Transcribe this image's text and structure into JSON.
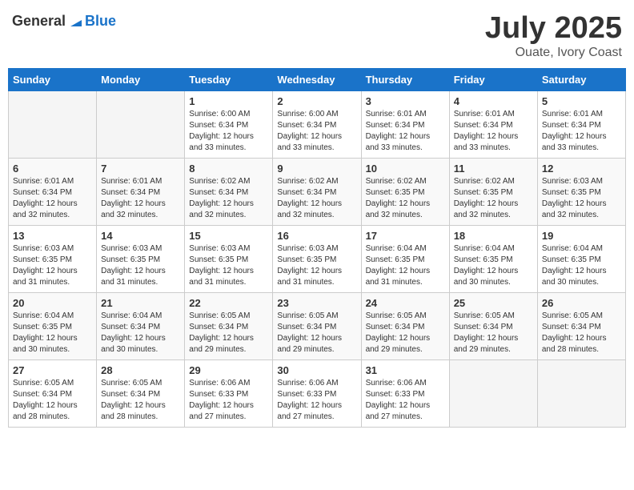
{
  "logo": {
    "general": "General",
    "blue": "Blue"
  },
  "title": "July 2025",
  "subtitle": "Ouate, Ivory Coast",
  "days_of_week": [
    "Sunday",
    "Monday",
    "Tuesday",
    "Wednesday",
    "Thursday",
    "Friday",
    "Saturday"
  ],
  "weeks": [
    [
      {
        "day": "",
        "sunrise": "",
        "sunset": "",
        "daylight": ""
      },
      {
        "day": "",
        "sunrise": "",
        "sunset": "",
        "daylight": ""
      },
      {
        "day": "1",
        "sunrise": "Sunrise: 6:00 AM",
        "sunset": "Sunset: 6:34 PM",
        "daylight": "Daylight: 12 hours and 33 minutes."
      },
      {
        "day": "2",
        "sunrise": "Sunrise: 6:00 AM",
        "sunset": "Sunset: 6:34 PM",
        "daylight": "Daylight: 12 hours and 33 minutes."
      },
      {
        "day": "3",
        "sunrise": "Sunrise: 6:01 AM",
        "sunset": "Sunset: 6:34 PM",
        "daylight": "Daylight: 12 hours and 33 minutes."
      },
      {
        "day": "4",
        "sunrise": "Sunrise: 6:01 AM",
        "sunset": "Sunset: 6:34 PM",
        "daylight": "Daylight: 12 hours and 33 minutes."
      },
      {
        "day": "5",
        "sunrise": "Sunrise: 6:01 AM",
        "sunset": "Sunset: 6:34 PM",
        "daylight": "Daylight: 12 hours and 33 minutes."
      }
    ],
    [
      {
        "day": "6",
        "sunrise": "Sunrise: 6:01 AM",
        "sunset": "Sunset: 6:34 PM",
        "daylight": "Daylight: 12 hours and 32 minutes."
      },
      {
        "day": "7",
        "sunrise": "Sunrise: 6:01 AM",
        "sunset": "Sunset: 6:34 PM",
        "daylight": "Daylight: 12 hours and 32 minutes."
      },
      {
        "day": "8",
        "sunrise": "Sunrise: 6:02 AM",
        "sunset": "Sunset: 6:34 PM",
        "daylight": "Daylight: 12 hours and 32 minutes."
      },
      {
        "day": "9",
        "sunrise": "Sunrise: 6:02 AM",
        "sunset": "Sunset: 6:34 PM",
        "daylight": "Daylight: 12 hours and 32 minutes."
      },
      {
        "day": "10",
        "sunrise": "Sunrise: 6:02 AM",
        "sunset": "Sunset: 6:35 PM",
        "daylight": "Daylight: 12 hours and 32 minutes."
      },
      {
        "day": "11",
        "sunrise": "Sunrise: 6:02 AM",
        "sunset": "Sunset: 6:35 PM",
        "daylight": "Daylight: 12 hours and 32 minutes."
      },
      {
        "day": "12",
        "sunrise": "Sunrise: 6:03 AM",
        "sunset": "Sunset: 6:35 PM",
        "daylight": "Daylight: 12 hours and 32 minutes."
      }
    ],
    [
      {
        "day": "13",
        "sunrise": "Sunrise: 6:03 AM",
        "sunset": "Sunset: 6:35 PM",
        "daylight": "Daylight: 12 hours and 31 minutes."
      },
      {
        "day": "14",
        "sunrise": "Sunrise: 6:03 AM",
        "sunset": "Sunset: 6:35 PM",
        "daylight": "Daylight: 12 hours and 31 minutes."
      },
      {
        "day": "15",
        "sunrise": "Sunrise: 6:03 AM",
        "sunset": "Sunset: 6:35 PM",
        "daylight": "Daylight: 12 hours and 31 minutes."
      },
      {
        "day": "16",
        "sunrise": "Sunrise: 6:03 AM",
        "sunset": "Sunset: 6:35 PM",
        "daylight": "Daylight: 12 hours and 31 minutes."
      },
      {
        "day": "17",
        "sunrise": "Sunrise: 6:04 AM",
        "sunset": "Sunset: 6:35 PM",
        "daylight": "Daylight: 12 hours and 31 minutes."
      },
      {
        "day": "18",
        "sunrise": "Sunrise: 6:04 AM",
        "sunset": "Sunset: 6:35 PM",
        "daylight": "Daylight: 12 hours and 30 minutes."
      },
      {
        "day": "19",
        "sunrise": "Sunrise: 6:04 AM",
        "sunset": "Sunset: 6:35 PM",
        "daylight": "Daylight: 12 hours and 30 minutes."
      }
    ],
    [
      {
        "day": "20",
        "sunrise": "Sunrise: 6:04 AM",
        "sunset": "Sunset: 6:35 PM",
        "daylight": "Daylight: 12 hours and 30 minutes."
      },
      {
        "day": "21",
        "sunrise": "Sunrise: 6:04 AM",
        "sunset": "Sunset: 6:34 PM",
        "daylight": "Daylight: 12 hours and 30 minutes."
      },
      {
        "day": "22",
        "sunrise": "Sunrise: 6:05 AM",
        "sunset": "Sunset: 6:34 PM",
        "daylight": "Daylight: 12 hours and 29 minutes."
      },
      {
        "day": "23",
        "sunrise": "Sunrise: 6:05 AM",
        "sunset": "Sunset: 6:34 PM",
        "daylight": "Daylight: 12 hours and 29 minutes."
      },
      {
        "day": "24",
        "sunrise": "Sunrise: 6:05 AM",
        "sunset": "Sunset: 6:34 PM",
        "daylight": "Daylight: 12 hours and 29 minutes."
      },
      {
        "day": "25",
        "sunrise": "Sunrise: 6:05 AM",
        "sunset": "Sunset: 6:34 PM",
        "daylight": "Daylight: 12 hours and 29 minutes."
      },
      {
        "day": "26",
        "sunrise": "Sunrise: 6:05 AM",
        "sunset": "Sunset: 6:34 PM",
        "daylight": "Daylight: 12 hours and 28 minutes."
      }
    ],
    [
      {
        "day": "27",
        "sunrise": "Sunrise: 6:05 AM",
        "sunset": "Sunset: 6:34 PM",
        "daylight": "Daylight: 12 hours and 28 minutes."
      },
      {
        "day": "28",
        "sunrise": "Sunrise: 6:05 AM",
        "sunset": "Sunset: 6:34 PM",
        "daylight": "Daylight: 12 hours and 28 minutes."
      },
      {
        "day": "29",
        "sunrise": "Sunrise: 6:06 AM",
        "sunset": "Sunset: 6:33 PM",
        "daylight": "Daylight: 12 hours and 27 minutes."
      },
      {
        "day": "30",
        "sunrise": "Sunrise: 6:06 AM",
        "sunset": "Sunset: 6:33 PM",
        "daylight": "Daylight: 12 hours and 27 minutes."
      },
      {
        "day": "31",
        "sunrise": "Sunrise: 6:06 AM",
        "sunset": "Sunset: 6:33 PM",
        "daylight": "Daylight: 12 hours and 27 minutes."
      },
      {
        "day": "",
        "sunrise": "",
        "sunset": "",
        "daylight": ""
      },
      {
        "day": "",
        "sunrise": "",
        "sunset": "",
        "daylight": ""
      }
    ]
  ]
}
